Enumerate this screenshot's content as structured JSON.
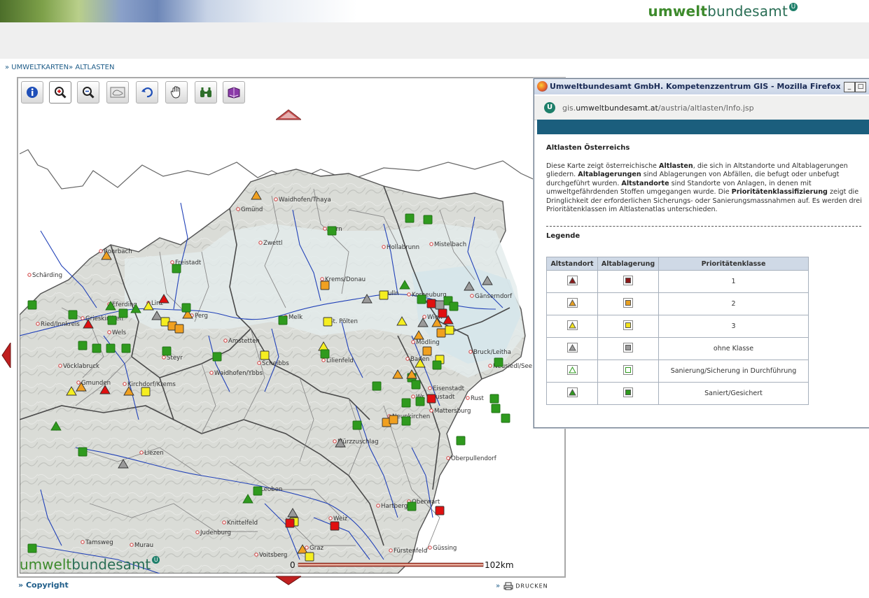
{
  "header": {
    "brand_part1": "umwelt",
    "brand_part2": "bundesamt",
    "brand_mark": "U"
  },
  "breadcrumb": {
    "prefix1": "» ",
    "item1": "UMWELTKARTEN",
    "prefix2": "» ",
    "item2": "ALTLASTEN"
  },
  "toolbar": {
    "tools": [
      {
        "name": "info-tool",
        "icon": "info-icon"
      },
      {
        "name": "zoom-in-tool",
        "icon": "zoom-in-icon"
      },
      {
        "name": "zoom-out-tool",
        "icon": "zoom-out-icon"
      },
      {
        "name": "full-extent-tool",
        "icon": "map-extent-icon"
      },
      {
        "name": "back-tool",
        "icon": "undo-icon"
      },
      {
        "name": "pan-tool",
        "icon": "hand-icon"
      },
      {
        "name": "overview-tool",
        "icon": "binoculars-icon"
      },
      {
        "name": "legend-tool",
        "icon": "book-icon"
      }
    ]
  },
  "map": {
    "places": [
      "Gmünd",
      "Waidhofen/Thaya",
      "Horn",
      "Zwettl",
      "Hollabrunn",
      "Mistelbach",
      "Rohrbach",
      "Freistadt",
      "Krems/Donau",
      "Korneuburg",
      "Gänserndorf",
      "Schärding",
      "Eferding",
      "Linz",
      "Perg",
      "Tulln",
      "Grieskirchen",
      "Ried/Innkreis",
      "Wels",
      "Melk",
      "St. Pölten",
      "Wien",
      "Mödling",
      "Amstetten",
      "Baden",
      "Bruck/Leitha",
      "Vöcklabruck",
      "Steyr",
      "Scheibbs",
      "Lilienfeld",
      "Neusiedl/See",
      "Gmunden",
      "Kirchdorf/Krems",
      "Waidhofen/Ybbs",
      "Eisenstadt",
      "Wr. Neustadt",
      "Rust",
      "Neunkirchen",
      "Mattersburg",
      "Mürzzuschlag",
      "Liezen",
      "Oberpullendorf",
      "Leoben",
      "Oberwart",
      "Hartberg",
      "Knittelfeld",
      "Weiz",
      "Judenburg",
      "Graz",
      "Tamsweg",
      "Murau",
      "Voitsberg",
      "Fürstenfeld",
      "Güssing"
    ],
    "scale_zero": "0",
    "scale_label": "102km",
    "logo_part1": "umwelt",
    "logo_part2": "bundesamt",
    "logo_mark": "U"
  },
  "footer": {
    "copyright_prefix": "» ",
    "copyright": "Copyright",
    "print_prefix": "»",
    "print": "DRUCKEN"
  },
  "popup": {
    "title": "Umweltbundesamt GmbH. Kompetenzzentrum GIS - Mozilla Firefox",
    "url_prefix": "gis.",
    "url_domain": "umweltbundesamt.at",
    "url_path": "/austria/altlasten/Info.jsp",
    "heading": "Altlasten Österreichs",
    "desc": [
      {
        "t": "Diese Karte zeigt österreichische ",
        "b": false
      },
      {
        "t": "Altlasten",
        "b": true
      },
      {
        "t": ", die sich in Altstandorte und Altablagerungen gliedern. ",
        "b": false
      },
      {
        "t": "Altablagerungen",
        "b": true
      },
      {
        "t": " sind Ablagerungen von Abfällen, die befugt oder unbefugt durchgeführt wurden. ",
        "b": false
      },
      {
        "t": "Altstandorte",
        "b": true
      },
      {
        "t": " sind Standorte von Anlagen, in denen mit umweltgefährdenden Stoffen umgegangen wurde. Die ",
        "b": false
      },
      {
        "t": "Prioritätenklassifizierung",
        "b": true
      },
      {
        "t": " zeigt die Dringlichkeit der erforderlichen Sicherungs- oder Sanierungsmassnahmen auf. Es werden drei Prioritätenklassen im Altlastenatlas unterschieden.",
        "b": false
      }
    ],
    "legend_title": "Legende",
    "legend": {
      "headers": [
        "Altstandort",
        "Altablagerung",
        "Prioritätenklasse"
      ],
      "rows": [
        {
          "label": "1",
          "color": "#8b1a1a"
        },
        {
          "label": "2",
          "color": "#e8a020"
        },
        {
          "label": "3",
          "color": "#f2e21c"
        },
        {
          "label": "ohne Klasse",
          "color": "#9a9a9a"
        },
        {
          "label": "Sanierung/Sicherung in Durchführung",
          "color": "#ffffff",
          "outline": "#2f9a1e"
        },
        {
          "label": "Saniert/Gesichert",
          "color": "#2f9a1e"
        }
      ]
    }
  },
  "colors": {
    "link": "#1f5d89",
    "teal_bar": "#1b5e7d",
    "site_red": "#e01010",
    "site_orange": "#f0a020",
    "site_yellow": "#f5ee20",
    "site_grey": "#9a9a9a",
    "site_green": "#2f9a1e"
  }
}
